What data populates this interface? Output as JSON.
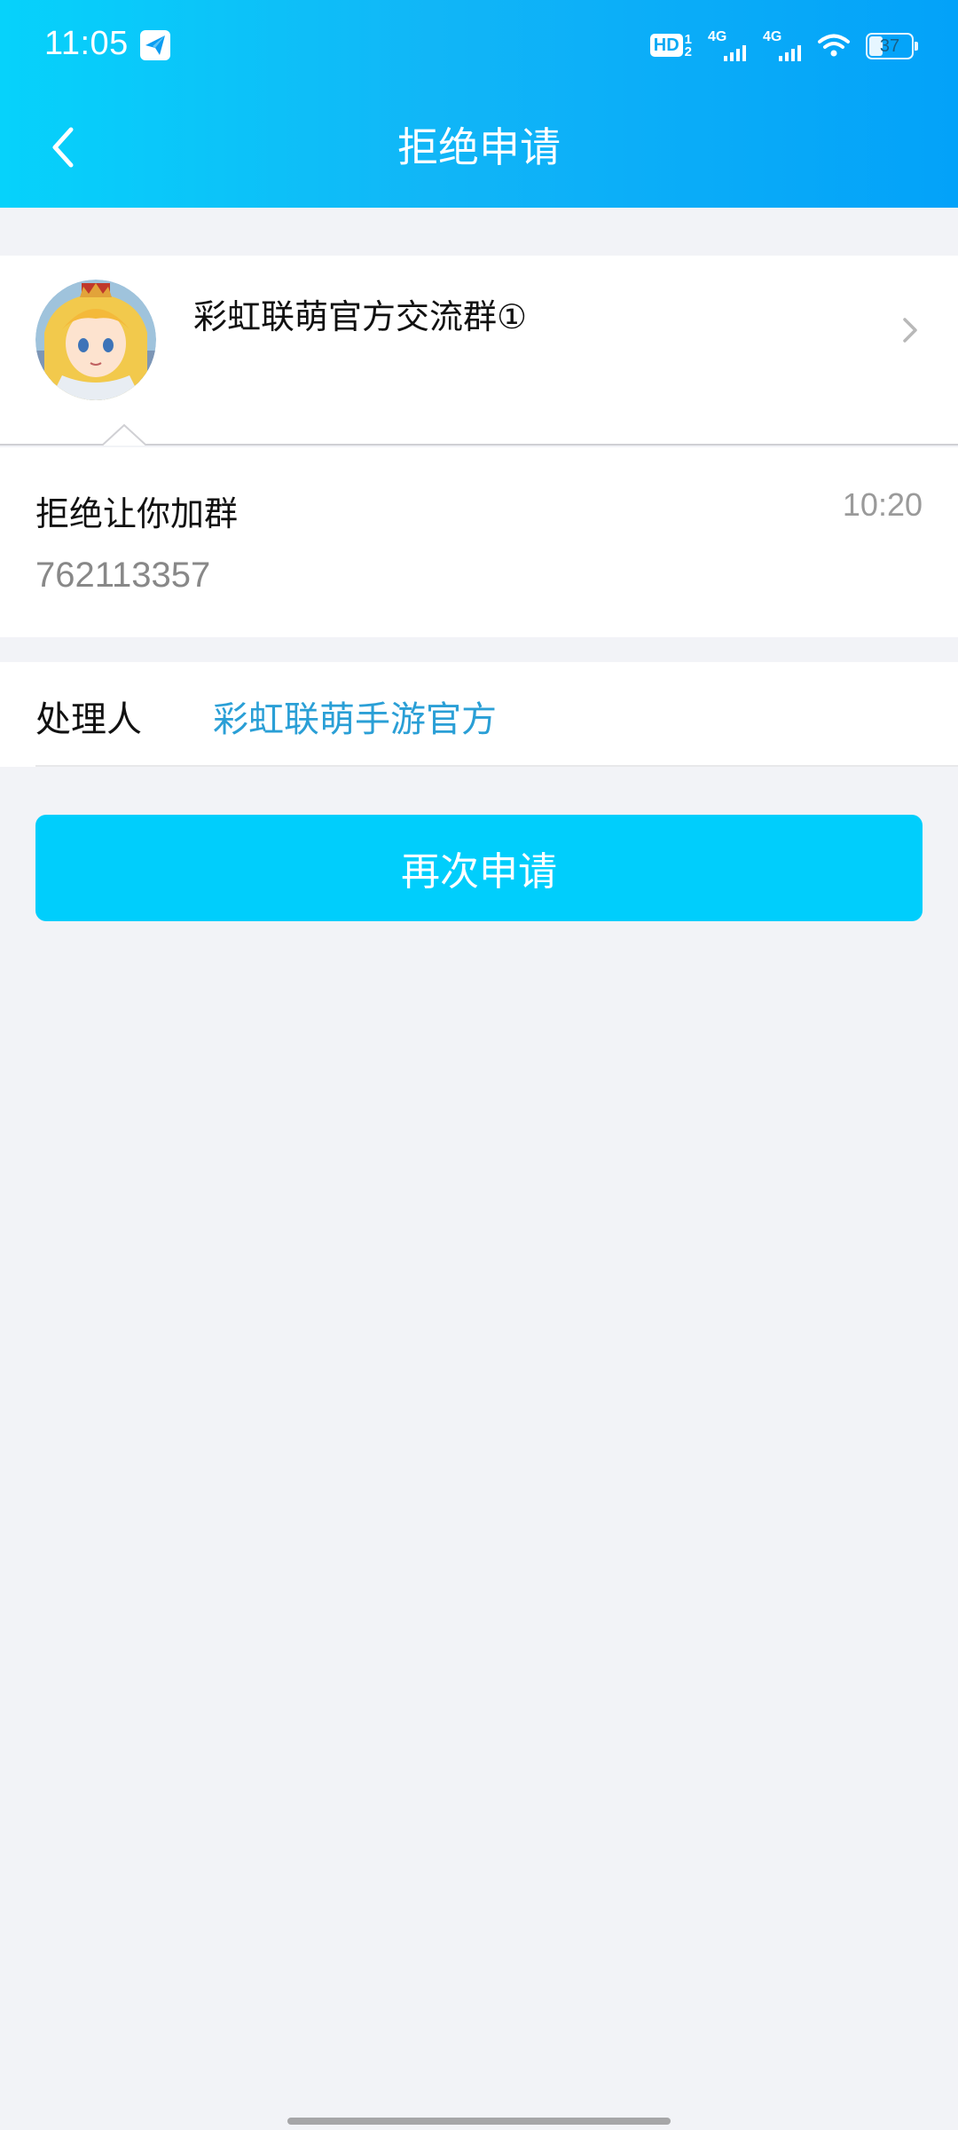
{
  "status_bar": {
    "time": "11:05",
    "hd_label": "HD",
    "hd_fraction_top": "1",
    "hd_fraction_bottom": "2",
    "network_1": "4G",
    "network_2": "4G",
    "battery_level": "37",
    "battery_fraction": 0.37
  },
  "header": {
    "title": "拒绝申请",
    "back_icon": "chevron-left-icon",
    "gradient_colors": [
      "#06d2fb",
      "#03a2f9"
    ]
  },
  "group": {
    "name": "彩虹联萌官方交流群①",
    "avatar_icon": "group-avatar",
    "chevron_icon": "chevron-right-icon"
  },
  "message": {
    "text": "拒绝让你加群",
    "time": "10:20",
    "number": "762113357"
  },
  "handler": {
    "label": "处理人",
    "value": "彩虹联萌手游官方",
    "value_color": "#2a9fd6"
  },
  "actions": {
    "reapply_label": "再次申请",
    "button_color": "#00cefc"
  }
}
